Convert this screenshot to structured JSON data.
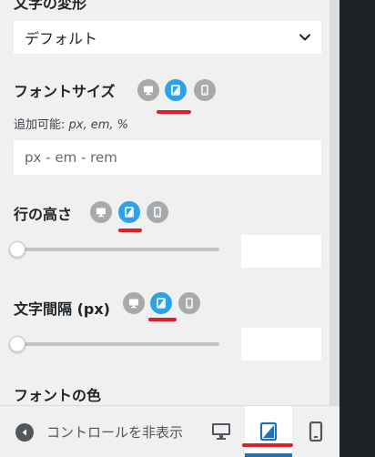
{
  "text_transform": {
    "label": "文字の変形",
    "value": "デフォルト"
  },
  "font_size": {
    "label": "フォントサイズ",
    "hint_prefix": "追加可能: ",
    "hint_units": "px, em, %",
    "placeholder": "px - em - rem",
    "active_device": "tablet"
  },
  "line_height": {
    "label": "行の高さ",
    "active_device": "tablet",
    "slider_value": 0
  },
  "letter_spacing": {
    "label": "文字間隔 (px)",
    "active_device": "tablet",
    "slider_value": 0
  },
  "font_color": {
    "label": "フォントの色"
  },
  "footer": {
    "collapse_label": "コントロールを非表示",
    "active_device": "tablet"
  },
  "colors": {
    "accent": "#2ea2e8",
    "device_inactive": "#a7aaad",
    "highlight": "#e01e26",
    "footer_active": "#2271b1"
  }
}
